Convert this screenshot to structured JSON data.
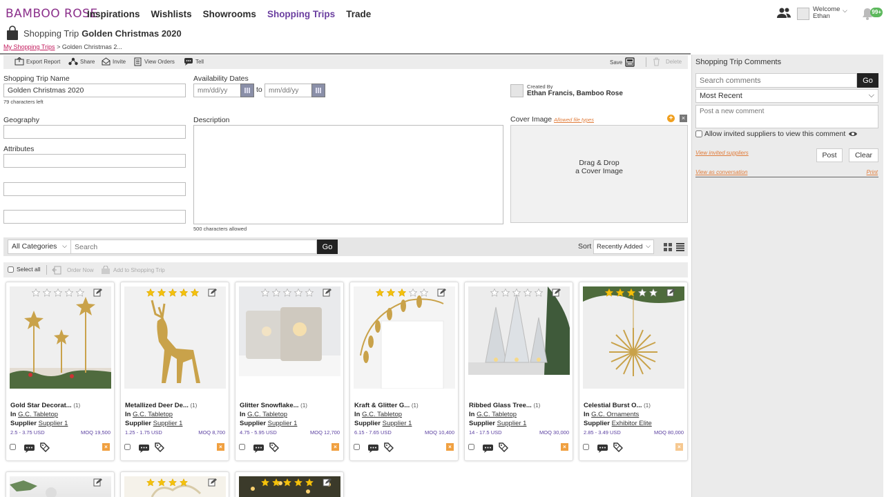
{
  "header": {
    "logo": "BAMBOO ROSE",
    "nav": [
      {
        "label": "Inspirations",
        "active": false
      },
      {
        "label": "Wishlists",
        "active": false
      },
      {
        "label": "Showrooms",
        "active": false
      },
      {
        "label": "Shopping Trips",
        "active": true
      },
      {
        "label": "Trade",
        "active": false
      }
    ],
    "welcome": "Welcome",
    "user": "Ethan",
    "notifications": "99+"
  },
  "trip": {
    "label": "Shopping Trip",
    "name": "Golden Christmas 2020"
  },
  "breadcrumb": {
    "link": "My Shopping Trips",
    "separator": ">",
    "current": "Golden Christmas 2..."
  },
  "toolbar": {
    "export": "Export Report",
    "share": "Share",
    "invite": "Invite",
    "view_orders": "View Orders",
    "tell": "Tell",
    "save": "Save",
    "delete": "Delete"
  },
  "form": {
    "name_label": "Shopping Trip Name",
    "name_value": "Golden Christmas 2020",
    "name_hint": "79 characters left",
    "avail_label": "Availability Dates",
    "date_placeholder": "mm/dd/yy",
    "to": "to",
    "created_by_label": "Created By",
    "created_by": "Ethan Francis, Bamboo Rose",
    "geo_label": "Geography",
    "desc_label": "Description",
    "desc_hint": "500 characters allowed",
    "attr_label": "Attributes",
    "cover_label": "Cover Image",
    "cover_link": "Allowed file types",
    "cover_drop_1": "Drag & Drop",
    "cover_drop_2": "a Cover Image"
  },
  "search": {
    "category": "All Categories",
    "placeholder": "Search",
    "go": "Go",
    "sort_label": "Sort",
    "sort_value": "Recently Added"
  },
  "selection": {
    "select_all": "Select all",
    "order_now": "Order Now",
    "add_to_trip": "Add to Shopping Trip"
  },
  "comments": {
    "title": "Shopping Trip Comments",
    "search_placeholder": "Search comments",
    "go": "Go",
    "sort": "Most Recent",
    "post_placeholder": "Post a new comment",
    "allow": "Allow invited suppliers to view this comment",
    "view_suppliers": "View invited suppliers",
    "post": "Post",
    "clear": "Clear",
    "view_conversation": "View as conversation",
    "print": "Print"
  },
  "products": [
    {
      "name": "Gold Star Decorat...",
      "qty": "(1)",
      "in_label": "In",
      "category": "G.C. Tabletop",
      "supplier_label": "Supplier",
      "supplier": "Supplier 1",
      "price": "2.5 - 3.75 USD",
      "moq": "MOQ 19,500",
      "rating": 0
    },
    {
      "name": "Metallized Deer De...",
      "qty": "(1)",
      "in_label": "In",
      "category": "G.C. Tabletop",
      "supplier_label": "Supplier",
      "supplier": "Supplier 1",
      "price": "1.25 - 1.75 USD",
      "moq": "MOQ 8,700",
      "rating": 5
    },
    {
      "name": "Glitter Snowflake...",
      "qty": "(1)",
      "in_label": "In",
      "category": "G.C. Tabletop",
      "supplier_label": "Supplier",
      "supplier": "Supplier 1",
      "price": "4.75 - 5.95 USD",
      "moq": "MOQ 12,700",
      "rating": 0
    },
    {
      "name": "Kraft & Glitter G...",
      "qty": "(1)",
      "in_label": "In",
      "category": "G.C. Tabletop",
      "supplier_label": "Supplier",
      "supplier": "Supplier 1",
      "price": "6.15 - 7.65 USD",
      "moq": "MOQ 10,400",
      "rating": 3
    },
    {
      "name": "Ribbed Glass Tree...",
      "qty": "(1)",
      "in_label": "In",
      "category": "G.C. Tabletop",
      "supplier_label": "Supplier",
      "supplier": "Supplier 1",
      "price": "14 - 17.5 USD",
      "moq": "MOQ 30,000",
      "rating": 0
    },
    {
      "name": "Celestial Burst O...",
      "qty": "(1)",
      "in_label": "In",
      "category": "G.C. Ornaments",
      "supplier_label": "Supplier",
      "supplier": "Exhibitor Elite",
      "price": "2.85 - 3.49 USD",
      "moq": "MOQ 80,000",
      "rating": 3
    }
  ],
  "colors": {
    "accent": "#6b3fa0",
    "link_orange": "#e07b39",
    "star_gold": "#f4c20d",
    "logo": "#8b2f8b"
  }
}
